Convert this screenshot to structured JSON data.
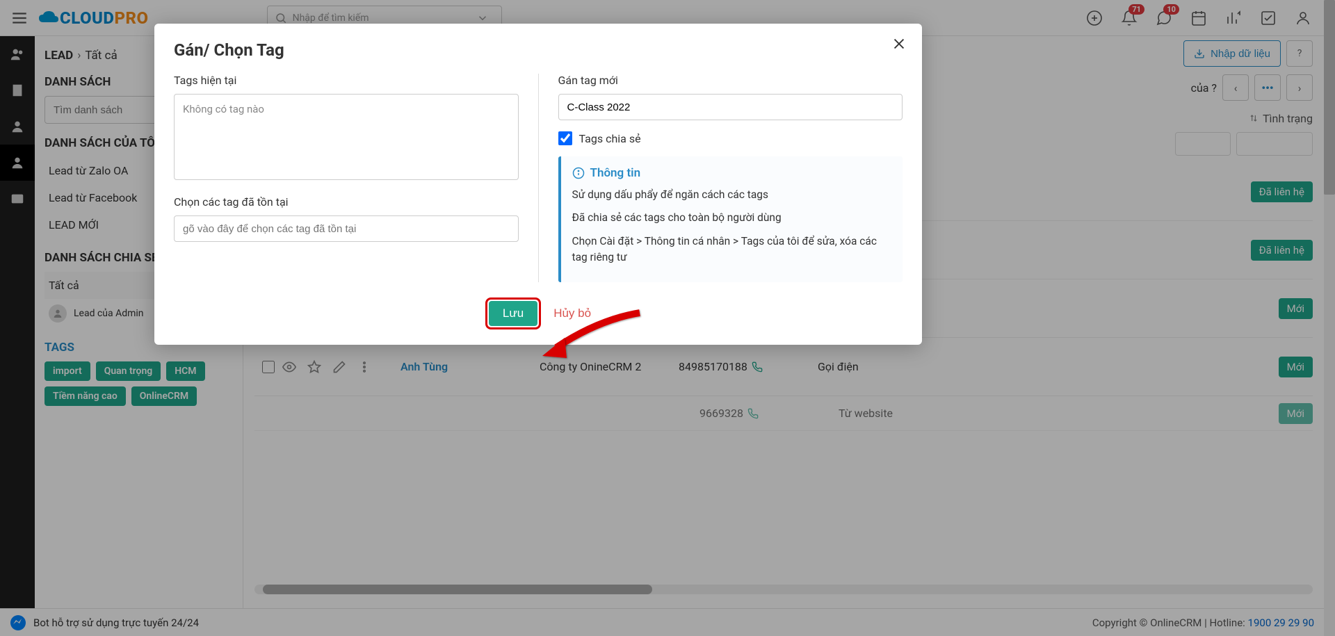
{
  "header": {
    "search_placeholder": "Nhập để tìm kiếm",
    "bell_badge": "71",
    "chat_badge": "10"
  },
  "breadcrumb": {
    "root": "LEAD",
    "current": "Tất cả"
  },
  "sidebar": {
    "list_title": "DANH SÁCH",
    "search_placeholder": "Tìm danh sách",
    "my_lists_title": "DANH SÁCH CỦA TÔI",
    "my_lists": [
      "Lead từ Zalo OA",
      "Lead từ Facebook",
      "LEAD MỚI"
    ],
    "shared_title": "DANH SÁCH CHIA SẺ",
    "shared_all": "Tất cả",
    "shared_admin": "Lead của Admin",
    "tags_title": "TAGS",
    "tags": [
      "import",
      "Quan trọng",
      "HCM",
      "Tiềm năng cao",
      "OnlineCRM"
    ]
  },
  "toolbar": {
    "import_label": "Nhập dữ liệu",
    "owner_text": "của ?",
    "status_label": "Tình trạng"
  },
  "rows": [
    {
      "name": "",
      "company": "",
      "phone": "",
      "src": "",
      "status": "Đã liên hệ"
    },
    {
      "name": "",
      "company": "",
      "phone": "",
      "src": "",
      "status": "Đã liên hệ"
    },
    {
      "name": "",
      "company": "",
      "phone": "",
      "src": "",
      "status": "Mới"
    },
    {
      "name": "Anh Tùng",
      "company": "Công ty OnineCRM 2",
      "phone": "84985170188",
      "src": "Gọi điện",
      "status": "Mới"
    },
    {
      "name": "",
      "company": "",
      "phone": "9669328",
      "src": "Từ website",
      "status": "Mới"
    }
  ],
  "modal": {
    "title": "Gán/ Chọn Tag",
    "tags_current_label": "Tags hiện tại",
    "no_tags": "Không có tag nào",
    "choose_existing_label": "Chọn các tag đã tồn tại",
    "choose_existing_placeholder": "gõ vào đây để chọn các tag đã tồn tại",
    "new_tag_label": "Gán tag mới",
    "new_tag_value": "C-Class 2022",
    "share_label": "Tags chia sẻ",
    "info_title": "Thông tin",
    "info_l1": "Sử dụng dấu phẩy để ngăn cách các tags",
    "info_l2": "Đã chia sẻ các tags cho toàn bộ người dùng",
    "info_l3": "Chọn Cài đặt > Thông tin cá nhân > Tags của tôi để sửa, xóa các tag riêng tư",
    "save": "Lưu",
    "cancel": "Hủy bỏ"
  },
  "footer": {
    "bot": "Bot hỗ trợ sử dụng trực tuyến 24/24",
    "copyright_prefix": "Copyright © OnlineCRM | Hotline: ",
    "phone": "1900 29 29 90"
  }
}
